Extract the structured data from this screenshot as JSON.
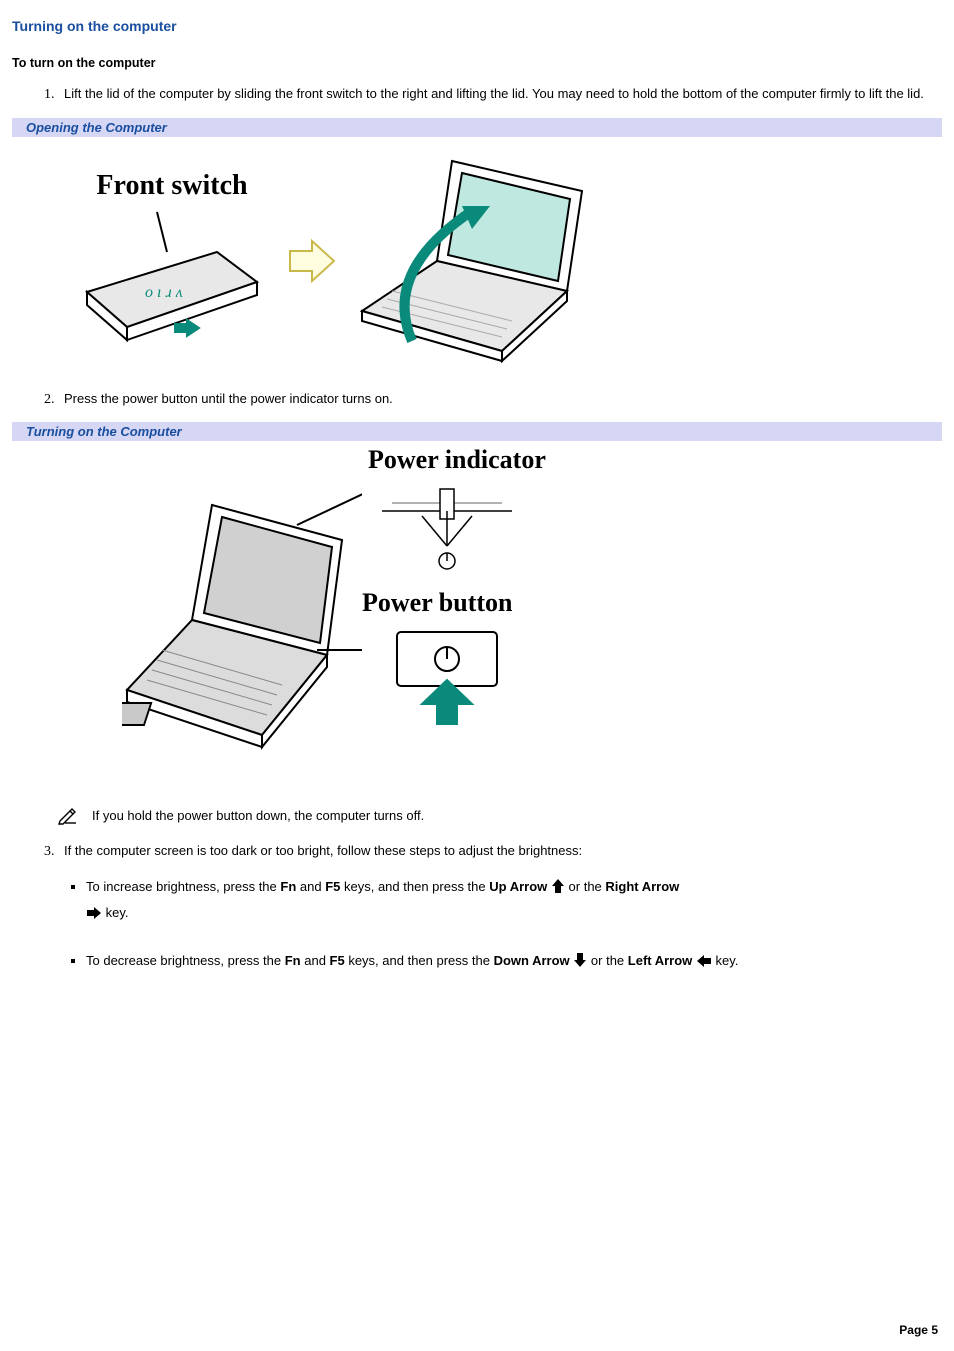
{
  "title": "Turning on the computer",
  "subheading": "To turn on the computer",
  "steps": {
    "s1": "Lift the lid of the computer by sliding the front switch to the right and lifting the lid. You may need to hold the bottom of the computer firmly to lift the lid.",
    "s2": "Press the power button until the power indicator turns on.",
    "s3": "If the computer screen is too dark or too bright, follow these steps to adjust the brightness:"
  },
  "captions": {
    "opening": "Opening the Computer",
    "turning_on": "Turning on the Computer"
  },
  "figure_labels": {
    "front_switch": "Front switch",
    "power_indicator": "Power indicator",
    "power_button": "Power button"
  },
  "note": "If you hold the power button down, the computer turns off.",
  "brightness": {
    "increase": {
      "pre": "To increase brightness, press the ",
      "fn": "Fn",
      "mid1": " and ",
      "f5": "F5",
      "mid2": " keys, and then press the ",
      "up": "Up Arrow",
      "mid3": " or the ",
      "right": "Right Arrow",
      "post": "key."
    },
    "decrease": {
      "pre": "To decrease brightness, press the ",
      "fn": "Fn",
      "mid1": " and ",
      "f5": "F5",
      "mid2": " keys, and then press the ",
      "down": "Down Arrow",
      "mid3": " or the ",
      "left": "Left Arrow",
      "post": " key."
    }
  },
  "footer": "Page 5"
}
